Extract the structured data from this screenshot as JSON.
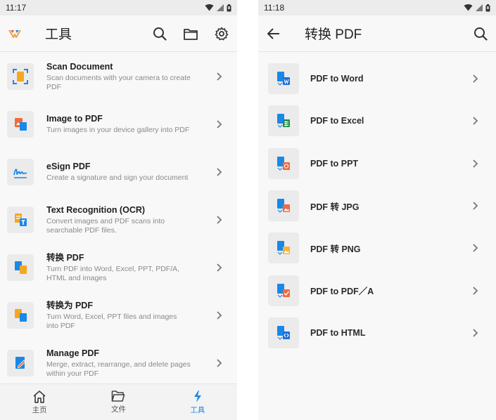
{
  "left": {
    "status": {
      "time": "11:17"
    },
    "app_bar": {
      "title": "工具"
    },
    "tools": [
      {
        "title": "Scan Document",
        "desc": "Scan documents with your camera to create PDF"
      },
      {
        "title": "Image to PDF",
        "desc": "Turn images in your device gallery into PDF"
      },
      {
        "title": "eSign PDF",
        "desc": "Create a signature and sign your document"
      },
      {
        "title": "Text Recognition (OCR)",
        "desc": "Convert images and PDF scans into searchable PDF files."
      },
      {
        "title": "转换 PDF",
        "desc": "Turn PDF into Word, Excel, PPT, PDF/A, HTML and images"
      },
      {
        "title": "转换为 PDF",
        "desc": "Turn Word, Excel, PPT files and images into PDF"
      },
      {
        "title": "Manage PDF",
        "desc": "Merge, extract, rearrange, and delete pages within your PDF"
      }
    ],
    "bottom_nav": [
      {
        "label": "主页"
      },
      {
        "label": "文件"
      },
      {
        "label": "工具"
      }
    ]
  },
  "right": {
    "status": {
      "time": "11:18"
    },
    "app_bar": {
      "title": "转换 PDF"
    },
    "items": [
      {
        "label": "PDF to Word",
        "badge_color": "#1e6fd9"
      },
      {
        "label": "PDF to Excel",
        "badge_color": "#1f8f4e"
      },
      {
        "label": "PDF to PPT",
        "badge_color": "#f26b3a"
      },
      {
        "label": "PDF 转 JPG",
        "badge_color": "#f26b3a"
      },
      {
        "label": "PDF 转 PNG",
        "badge_color": "#f5b335"
      },
      {
        "label": "PDF to PDF／A",
        "badge_color": "#f26b3a"
      },
      {
        "label": "PDF to HTML",
        "badge_color": "#1e6fd9"
      }
    ]
  },
  "colors": {
    "accent": "#1a88e8",
    "doc_blue": "#1a88e8",
    "doc_orange": "#f5a623"
  }
}
